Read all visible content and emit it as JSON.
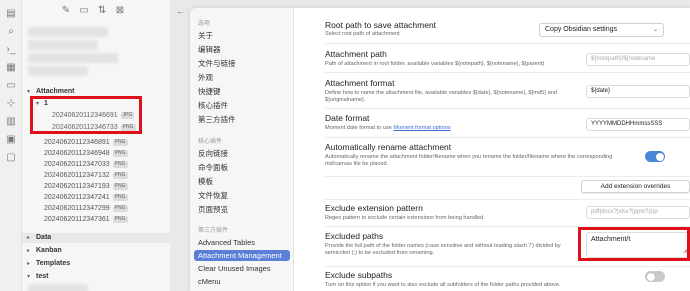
{
  "ribbon": {
    "icons": [
      "files-icon",
      "search-icon",
      "terminal-icon",
      "calendar-icon",
      "template-icon",
      "graph-icon",
      "kanban-icon",
      "clipboard-icon",
      "folder-icon"
    ]
  },
  "explorer": {
    "toolbar_icons": [
      "new-note-icon",
      "new-folder-icon",
      "sort-icon",
      "collapse-icon"
    ],
    "folders": {
      "attachment": "Attachment",
      "data": "Data",
      "kanban": "Kanban",
      "templates": "Templates",
      "test": "test"
    },
    "subfolder": "1",
    "subfolder_files": [
      {
        "name": "20240620112346691",
        "ext": "JPG"
      },
      {
        "name": "20240620112346733",
        "ext": "PNG"
      }
    ],
    "attachment_files": [
      {
        "name": "20240620112346891",
        "ext": "PNG"
      },
      {
        "name": "20240620112346948",
        "ext": "PNG"
      },
      {
        "name": "20240620112347033",
        "ext": "PNG"
      },
      {
        "name": "20240620112347132",
        "ext": "PNG"
      },
      {
        "name": "20240620112347193",
        "ext": "PNG"
      },
      {
        "name": "20240620112347241",
        "ext": "PNG"
      },
      {
        "name": "20240620112347299",
        "ext": "PNG"
      },
      {
        "name": "20240620112347361",
        "ext": "PNG"
      }
    ]
  },
  "settings_nav": {
    "group1_head": "选项",
    "group1": [
      "关于",
      "编辑器",
      "文件与链接",
      "外观",
      "快捷键",
      "核心插件",
      "第三方插件"
    ],
    "group2_head": "核心插件",
    "group2": [
      "反向链接",
      "命令面板",
      "模板",
      "文件恢复",
      "页面预览"
    ],
    "group3_head": "第三方插件",
    "group3": [
      "Advanced Tables",
      "Attachment Management",
      "Clear Unused Images",
      "cMenu"
    ],
    "active": "Attachment Management"
  },
  "settings": {
    "root_path": {
      "title": "Root path to save attachment",
      "desc": "Select root path of attachment",
      "value": "Copy Obsidian settings"
    },
    "attachment_path": {
      "title": "Attachment path",
      "desc": "Path of attachment in root folder, available variables ${notepath}, ${notename}, ${parent}",
      "placeholder": "${notepath}/${notename"
    },
    "attachment_format": {
      "title": "Attachment format",
      "desc": "Define how to name the attachment file, available variables ${date}, ${notename}, ${md5} and ${originalname}.",
      "value": "${date}"
    },
    "date_format": {
      "title": "Date format",
      "desc": "Moment date format to use",
      "link": "Moment format options",
      "value": "YYYYMMDDHHmmssSSS"
    },
    "auto_rename": {
      "title": "Automatically rename attachment",
      "desc": "Automatically rename the attachment folder/filename when you rename the folder/filename where the corresponding md/canvas file be placed.",
      "enabled": true
    },
    "add_extension_overrides": "Add extension overrides",
    "exclude_extension": {
      "title": "Exclude extension pattern",
      "desc": "Regex pattern to exclude certain extensions from being handled.",
      "placeholder": "pdf|docx?|xlsx?|pptx?|zip"
    },
    "excluded_paths": {
      "title": "Excluded paths",
      "desc": "Provide the full path of the folder names (case sensitive and without leading slash '/') divided by semicolon (;) to be excluded from renaming.",
      "value": "Attachment/t"
    },
    "exclude_subpaths": {
      "title": "Exclude subpaths",
      "desc": "Turn on this option if you want to also exclude all subfolders of the folder paths provided above.",
      "enabled": false
    }
  },
  "colors": {
    "accent": "#5b7fd6",
    "toggle_on": "#4a86d8",
    "toggle_off": "#c9c9c9",
    "highlight_box": "#e0101a"
  }
}
